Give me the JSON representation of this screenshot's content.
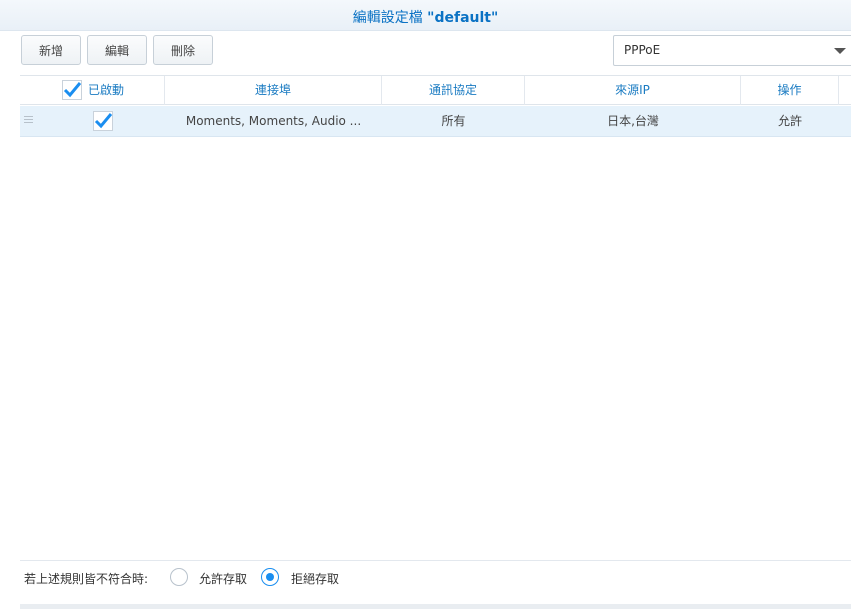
{
  "window": {
    "title_prefix": "編輯設定檔",
    "title_name": "\"default\""
  },
  "toolbar": {
    "create_label": "新增",
    "edit_label": "編輯",
    "delete_label": "刪除"
  },
  "interface_select": {
    "value": "PPPoE"
  },
  "grid": {
    "columns": {
      "enabled": "已啟動",
      "ports": "連接埠",
      "protocol": "通訊協定",
      "source_ip": "來源IP",
      "action": "操作"
    },
    "rows": [
      {
        "enabled": true,
        "ports": "Moments, Moments, Audio ...",
        "protocol": "所有",
        "source_ip": "日本,台灣",
        "action": "允許"
      }
    ]
  },
  "default_policy": {
    "label": "若上述規則皆不符合時:",
    "options": [
      {
        "label": "允許存取",
        "selected": false
      },
      {
        "label": "拒絕存取",
        "selected": true
      }
    ]
  },
  "colors": {
    "accent": "#1a8ef0",
    "header_text": "#1a7bc2",
    "row_selected": "#e6f2fb"
  }
}
